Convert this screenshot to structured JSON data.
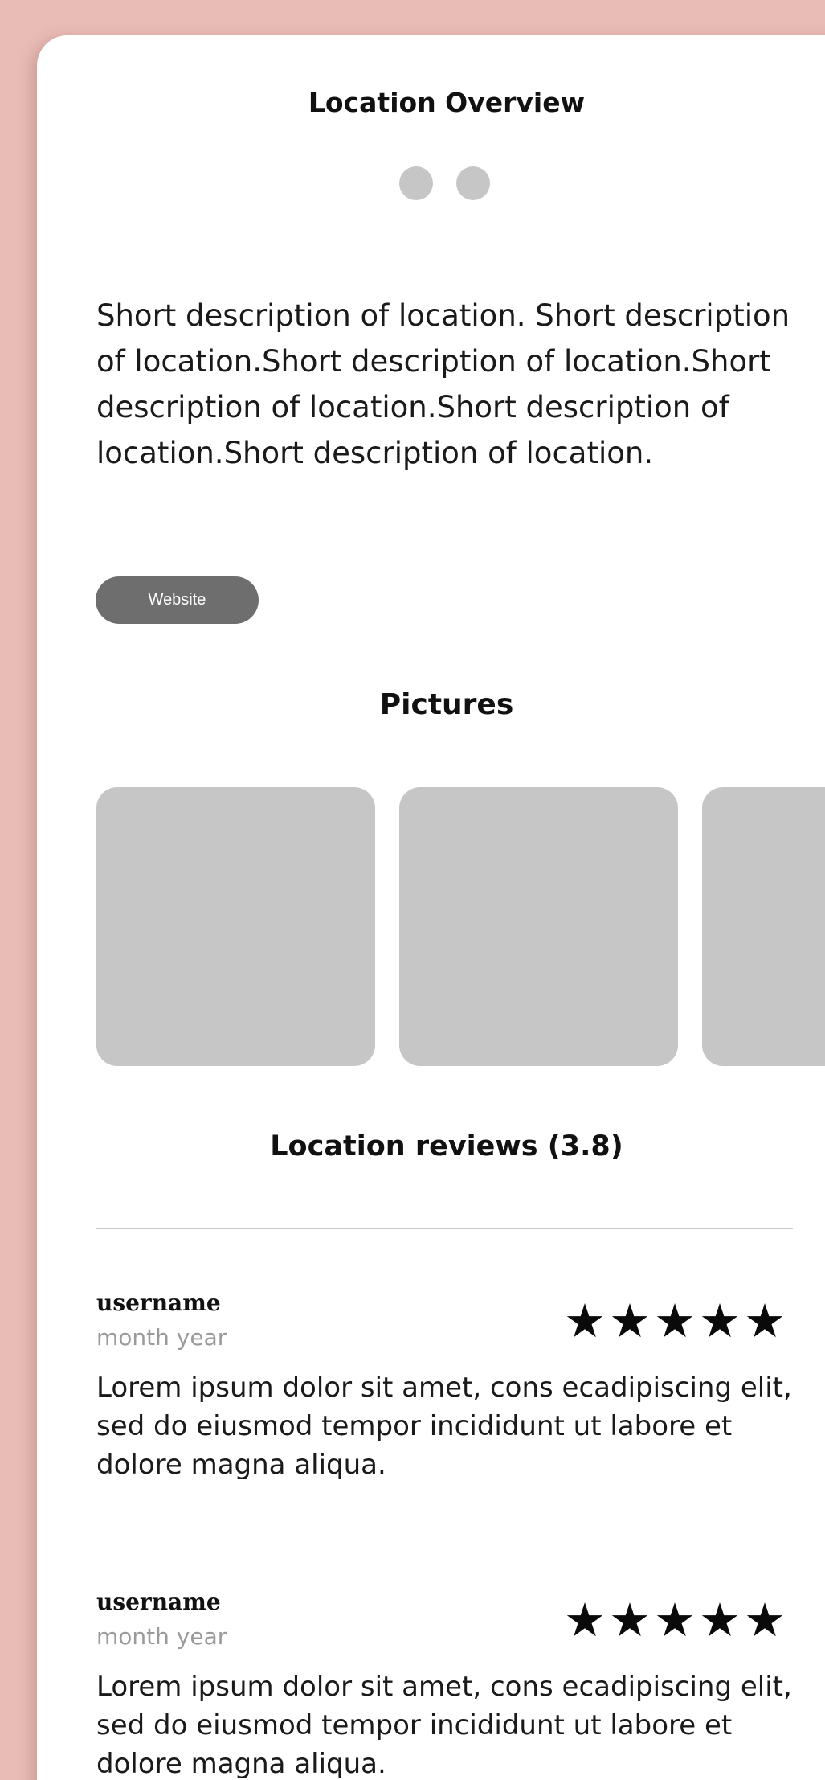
{
  "overview": {
    "title": "Location Overview",
    "description": "Short description of location. Short description of location.Short description of location.Short description of location.Short description of location.Short description of location.",
    "website_label": "Website"
  },
  "carousel": {
    "dots": 2
  },
  "pictures": {
    "title": "Pictures"
  },
  "reviews": {
    "title": "Location reviews (3.8)",
    "items": [
      {
        "username": "username",
        "date": "month year",
        "stars": "★★★★★",
        "rating": 5,
        "text": "Lorem ipsum dolor sit amet, cons ecadipiscing elit, sed do eiusmod tempor incididunt ut labore et dolore magna aliqua."
      },
      {
        "username": "username",
        "date": "month year",
        "stars": "★★★★★",
        "rating": 5,
        "text": "Lorem ipsum dolor sit amet, cons ecadipiscing elit, sed do eiusmod tempor incididunt ut labore et dolore magna aliqua."
      }
    ]
  },
  "colors": {
    "background": "#e9bcb6",
    "card": "#ffffff",
    "button": "#6e6e6e",
    "placeholder": "#c6c6c6",
    "date_text": "#9a9a9a"
  }
}
